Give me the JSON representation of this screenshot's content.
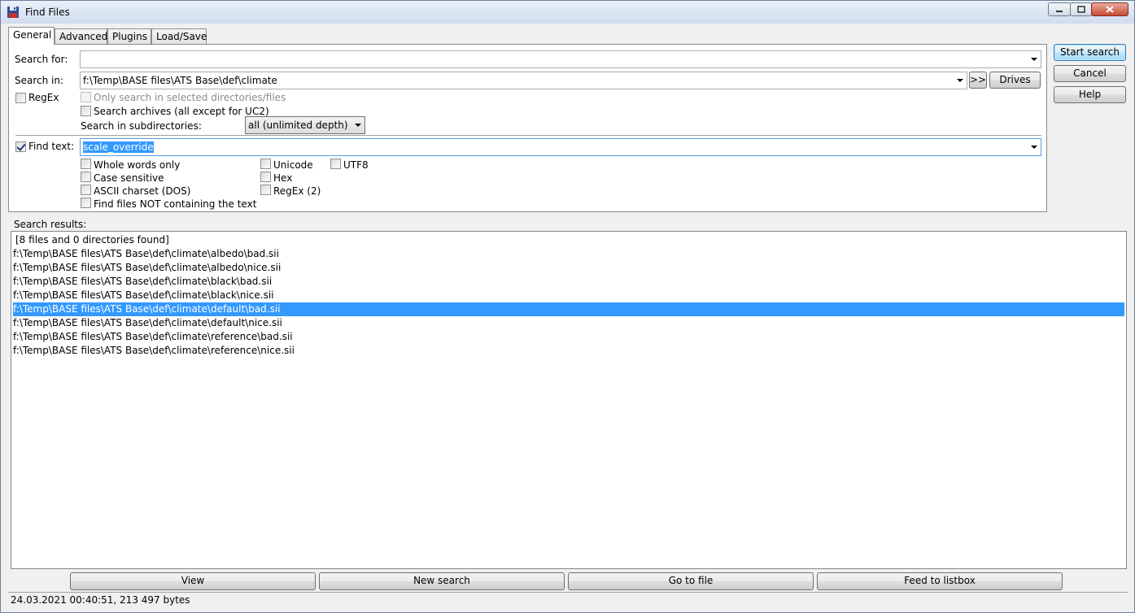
{
  "window": {
    "title": "Find Files"
  },
  "tabs": [
    "General",
    "Advanced",
    "Plugins",
    "Load/Save"
  ],
  "general": {
    "search_for_label": "Search for:",
    "search_for_value": "",
    "search_in_label": "Search in:",
    "search_in_value": "f:\\Temp\\BASE files\\ATS Base\\def\\climate",
    "browse_label": ">>",
    "drives_label": "Drives",
    "regex_label": "RegEx",
    "only_selected_label": "Only search in selected directories/files",
    "search_archives_label": "Search archives (all except for UC2)",
    "subdirs_label": "Search in subdirectories:",
    "subdirs_value": "all (unlimited depth)",
    "find_text_label": "Find text:",
    "find_text_value": "scale_override",
    "options": {
      "whole_words": "Whole words only",
      "case_sensitive": "Case sensitive",
      "ascii": "ASCII charset (DOS)",
      "not_containing": "Find files NOT containing the text",
      "unicode": "Unicode",
      "hex": "Hex",
      "regex2": "RegEx (2)",
      "utf8": "UTF8"
    }
  },
  "side_buttons": {
    "start": "Start search",
    "cancel": "Cancel",
    "help": "Help"
  },
  "results": {
    "label": "Search results:",
    "summary": "[8 files and 0 directories found]",
    "items": [
      "f:\\Temp\\BASE files\\ATS Base\\def\\climate\\albedo\\bad.sii",
      "f:\\Temp\\BASE files\\ATS Base\\def\\climate\\albedo\\nice.sii",
      "f:\\Temp\\BASE files\\ATS Base\\def\\climate\\black\\bad.sii",
      "f:\\Temp\\BASE files\\ATS Base\\def\\climate\\black\\nice.sii",
      "f:\\Temp\\BASE files\\ATS Base\\def\\climate\\default\\bad.sii",
      "f:\\Temp\\BASE files\\ATS Base\\def\\climate\\default\\nice.sii",
      "f:\\Temp\\BASE files\\ATS Base\\def\\climate\\reference\\bad.sii",
      "f:\\Temp\\BASE files\\ATS Base\\def\\climate\\reference\\nice.sii"
    ],
    "selected_index": 4
  },
  "bottom_buttons": {
    "view": "View",
    "new_search": "New search",
    "go_to_file": "Go to file",
    "feed": "Feed to listbox"
  },
  "status": "24.03.2021 00:40:51, 213 497 bytes",
  "colors": {
    "selection": "#3399ff",
    "title_gradient_top": "#e9f0fa",
    "close_button": "#c64a32"
  }
}
